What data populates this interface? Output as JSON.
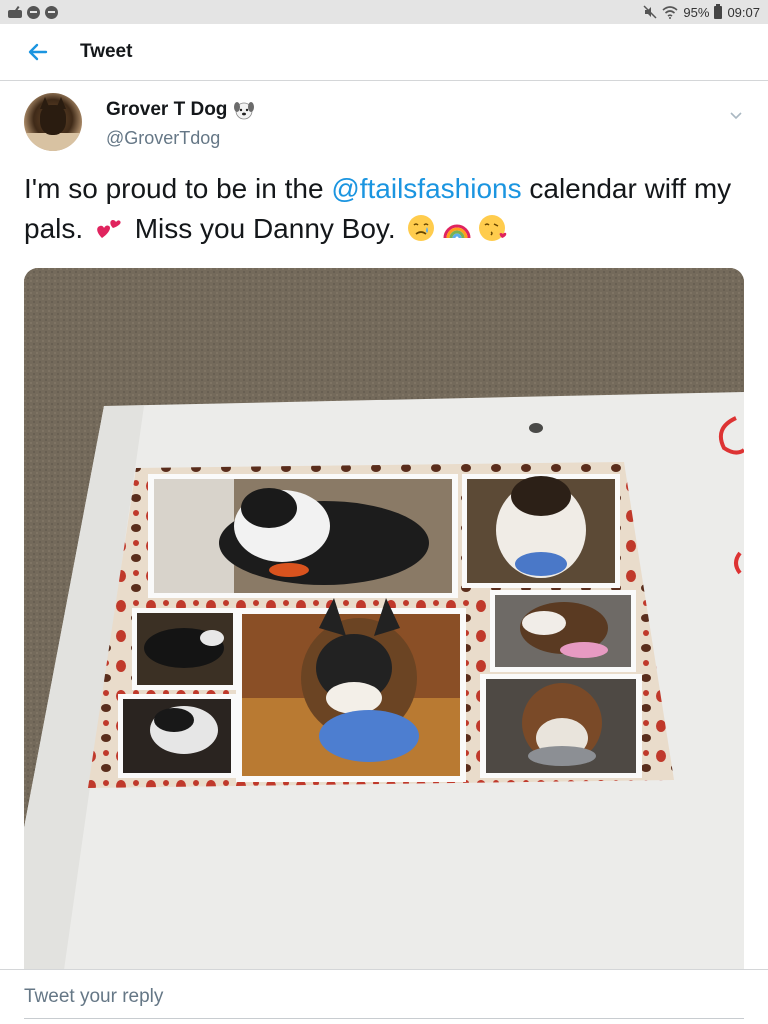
{
  "status_bar": {
    "battery": "95%",
    "time": "09:07",
    "icons": [
      "notification-icon",
      "messenger-icon",
      "messenger-icon",
      "mute-icon",
      "wifi-icon",
      "battery-icon"
    ]
  },
  "header": {
    "title": "Tweet",
    "back_icon": "arrow-left-icon"
  },
  "tweet": {
    "author": {
      "display_name": "Grover T Dog",
      "handle": "@GroverTdog",
      "name_emoji": "dog-face-emoji"
    },
    "text": {
      "part1": "I'm so proud to be in the ",
      "mention": "@ftailsfashions",
      "part2": " calendar wiff my pals. ",
      "part3": " Miss you Danny Boy. ",
      "emojis": [
        "two-hearts-emoji",
        "crying-face-emoji",
        "rainbow-emoji",
        "kissing-heart-emoji"
      ]
    },
    "media_description_icon": "photo-collage"
  },
  "reply": {
    "placeholder": "Tweet your reply"
  },
  "colors": {
    "accent": "#1b95e0",
    "secondary_text": "#657786",
    "divider": "#d4d6d8"
  }
}
